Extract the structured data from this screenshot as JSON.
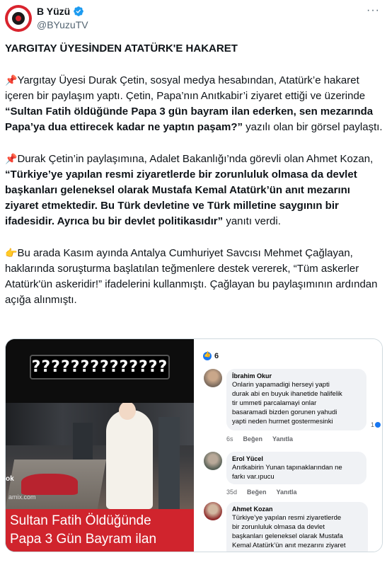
{
  "account": {
    "display_name": "B Yüzü",
    "handle": "@BYuzuTV",
    "verified": true,
    "more_label": "···"
  },
  "tweet": {
    "headline": "YARGITAY ÜYESİNDEN ATATÜRK'E HAKARET",
    "para1_pin": "📌",
    "para1_a": "Yargıtay Üyesi Durak Çetin, sosyal medya hesabından, Atatürk’e hakaret içeren bir paylaşım yaptı. Çetin, Papa’nın Anıtkabir’i ziyaret ettiği ve üzerinde ",
    "para1_bold": "“Sultan Fatih öldüğünde Papa 3 gün bayram ilan ederken, sen mezarında Papa’ya dua ettirecek kadar ne yaptın paşam?”",
    "para1_b": " yazılı olan bir görsel paylaştı.",
    "para2_pin": "📌",
    "para2_a": "Durak Çetin’in paylaşımına, Adalet Bakanlığı’nda görevli olan Ahmet Kozan, ",
    "para2_bold": "“Türkiye’ye yapılan resmi ziyaretlerde bir zorunluluk olmasa da devlet başkanları geleneksel olarak Mustafa Kemal Atatürk’ün anıt mezarını ziyaret etmektedir. Bu Türk devletine ve Türk milletine saygının bir ifadesidir. Ayrıca bu bir devlet politikasıdır”",
    "para2_b": " yanıtı verdi.",
    "para3_hand": "👉",
    "para3": "Bu arada Kasım ayında Antalya Cumhuriyet Savcısı Mehmet Çağlayan, haklarında soruşturma başlatılan teğmenlere destek vererek, “Tüm askerler Atatürk'ün askeridir!” ifadelerini kullanmıştı. Çağlayan bu paylaşımının ardından açığa alınmıştı."
  },
  "media_left": {
    "question_marks": "??????????????",
    "watermark": "amix.com",
    "edge_letter": "ok",
    "caption_line1": "Sultan Fatih Öldüğünde",
    "caption_line2": "Papa 3 Gün Bayram ilan"
  },
  "media_right": {
    "reaction_count": "6",
    "comments": [
      {
        "name": "İbrahim Okur",
        "text": [
          "Onlarin yapamadigi herseyi yapti",
          "durak abi en buyuk ihanetide halifelik",
          "tir ummeti parcalamayi onlar",
          "basaramadi bizden gorunen yahudi",
          "yapti neden hurmet gostermesinki"
        ],
        "time": "6s",
        "like": "Beğen",
        "reply": "Yanıtla",
        "likes": "1"
      },
      {
        "name": "Erol Yücel",
        "text": [
          "Anıtkabirin Yunan tapınaklarından ne",
          "farkı var.ıpucu"
        ],
        "time": "35d",
        "like": "Beğen",
        "reply": "Yanıtla"
      },
      {
        "name": "Ahmet Kozan",
        "text": [
          "Türkiye’ye yapılan resmi ziyaretlerde",
          "bir zorunluluk olmasa da devlet",
          "başkanları geleneksel olarak Mustafa",
          "Kemal Atatürk’ün anıt mezarını ziyaret"
        ]
      }
    ]
  },
  "colors": {
    "text": "#0f1419",
    "secondary": "#536471",
    "verified_blue": "#1d9bf0",
    "caption_red": "#d0242d"
  }
}
